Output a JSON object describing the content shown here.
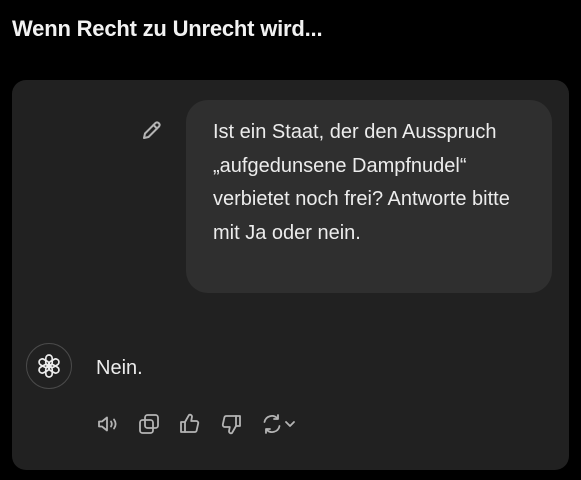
{
  "page": {
    "title": "Wenn Recht zu Unrecht wird..."
  },
  "user_message": {
    "text": "Ist ein Staat, der den Ausspruch „aufgedunsene Dampfnudel“ verbietet noch frei? Antworte bitte mit Ja oder nein.",
    "edit_icon": "pencil-icon"
  },
  "assistant_message": {
    "avatar_icon": "openai-logo-icon",
    "text": "Nein."
  },
  "actions": [
    {
      "name": "read-aloud",
      "icon": "speaker-icon"
    },
    {
      "name": "copy",
      "icon": "copy-icon"
    },
    {
      "name": "good-response",
      "icon": "thumbs-up-icon"
    },
    {
      "name": "bad-response",
      "icon": "thumbs-down-icon"
    },
    {
      "name": "regenerate",
      "icon": "refresh-icon"
    }
  ],
  "colors": {
    "background": "#000000",
    "card": "#212121",
    "bubble": "#2f2f2f",
    "text": "#ececec",
    "icon": "#b4b4b4"
  }
}
